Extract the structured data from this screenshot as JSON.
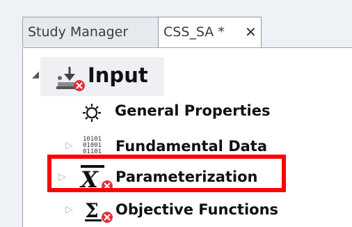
{
  "tabs": [
    {
      "label": "Study Manager"
    },
    {
      "label": "CSS_SA *",
      "close_glyph": "✕"
    }
  ],
  "tree": {
    "root": {
      "label": "Input",
      "icon": "input-download-icon"
    },
    "children": [
      {
        "label": "General Properties",
        "icon": "gear-icon"
      },
      {
        "label": "Fundamental Data",
        "icon": "binary-data-icon"
      },
      {
        "label": "Parameterization",
        "icon": "x-variable-icon"
      },
      {
        "label": "Objective Functions",
        "icon": "sigma-icon"
      }
    ]
  },
  "colors": {
    "error_badge": "#e0303a",
    "highlight": "#ff0000"
  }
}
